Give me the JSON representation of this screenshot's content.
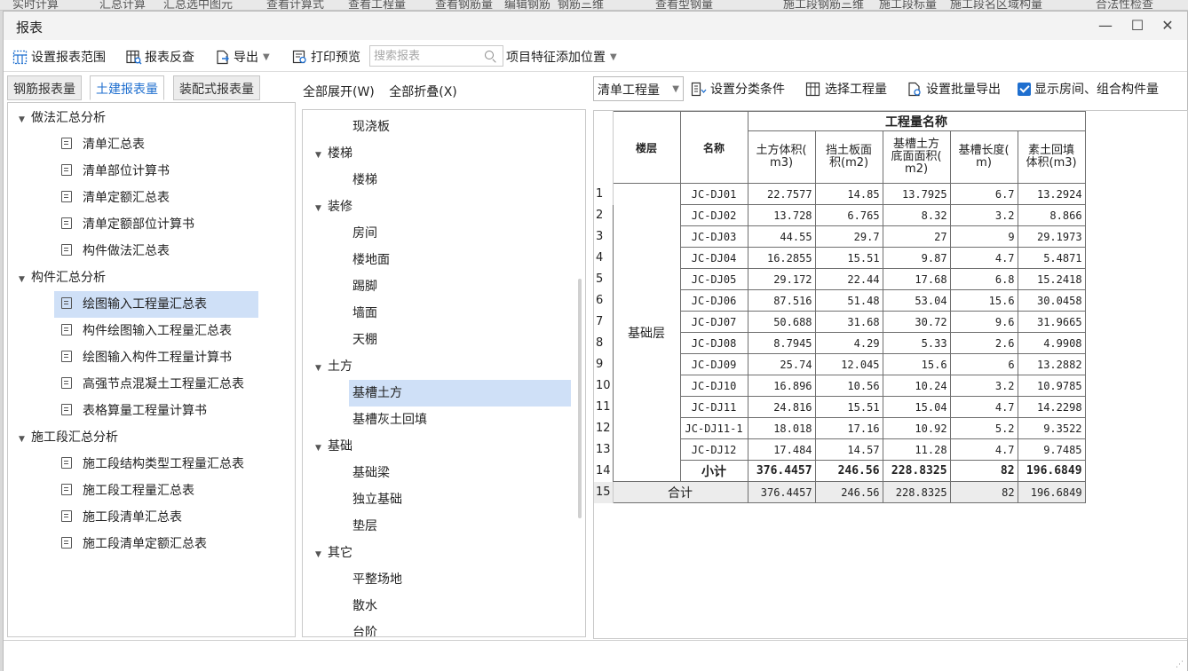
{
  "background_tabs": [
    "实时计算",
    "汇总计算",
    "汇总选中图元",
    "查看计算式",
    "查看工程量",
    "查看钢筋量",
    "编辑钢筋",
    "钢筋三维",
    "查看型钢量",
    "施工段钢筋三维",
    "施工段标量",
    "施工段名区域构量",
    "合法性检查"
  ],
  "window": {
    "title": "报表",
    "minimize": "—",
    "maximize": "☐",
    "close": "✕"
  },
  "toolbar": {
    "set_range": "设置报表范围",
    "reverse_check": "报表反查",
    "export": "导出",
    "print_preview": "打印预览",
    "search_placeholder": "搜索报表",
    "feature_position": "项目特征添加位置"
  },
  "left_tabs": [
    "钢筋报表量",
    "土建报表量",
    "装配式报表量"
  ],
  "left_tree": [
    {
      "label": "做法汇总分析",
      "level": 0
    },
    {
      "label": "清单汇总表",
      "level": 1
    },
    {
      "label": "清单部位计算书",
      "level": 1
    },
    {
      "label": "清单定额汇总表",
      "level": 1
    },
    {
      "label": "清单定额部位计算书",
      "level": 1
    },
    {
      "label": "构件做法汇总表",
      "level": 1
    },
    {
      "label": "构件汇总分析",
      "level": 0
    },
    {
      "label": "绘图输入工程量汇总表",
      "level": 1,
      "selected": true
    },
    {
      "label": "构件绘图输入工程量汇总表",
      "level": 1
    },
    {
      "label": "绘图输入构件工程量计算书",
      "level": 1
    },
    {
      "label": "高强节点混凝土工程量汇总表",
      "level": 1
    },
    {
      "label": "表格算量工程量计算书",
      "level": 1
    },
    {
      "label": "施工段汇总分析",
      "level": 0
    },
    {
      "label": "施工段结构类型工程量汇总表",
      "level": 1
    },
    {
      "label": "施工段工程量汇总表",
      "level": 1
    },
    {
      "label": "施工段清单汇总表",
      "level": 1
    },
    {
      "label": "施工段清单定额汇总表",
      "level": 1
    }
  ],
  "middle": {
    "expand_all": "全部展开(W)",
    "collapse_all": "全部折叠(X)",
    "items": [
      {
        "label": "现浇板",
        "level": 1
      },
      {
        "label": "楼梯",
        "level": 0
      },
      {
        "label": "楼梯",
        "level": 1
      },
      {
        "label": "装修",
        "level": 0
      },
      {
        "label": "房间",
        "level": 1
      },
      {
        "label": "楼地面",
        "level": 1
      },
      {
        "label": "踢脚",
        "level": 1
      },
      {
        "label": "墙面",
        "level": 1
      },
      {
        "label": "天棚",
        "level": 1
      },
      {
        "label": "土方",
        "level": 0
      },
      {
        "label": "基槽土方",
        "level": 1,
        "selected": true
      },
      {
        "label": "基槽灰土回填",
        "level": 1
      },
      {
        "label": "基础",
        "level": 0
      },
      {
        "label": "基础梁",
        "level": 1
      },
      {
        "label": "独立基础",
        "level": 1
      },
      {
        "label": "垫层",
        "level": 1
      },
      {
        "label": "其它",
        "level": 0
      },
      {
        "label": "平整场地",
        "level": 1
      },
      {
        "label": "散水",
        "level": 1
      },
      {
        "label": "台阶",
        "level": 1
      }
    ]
  },
  "right_toolbar": {
    "report_type": "清单工程量",
    "set_category": "设置分类条件",
    "select_quantity": "选择工程量",
    "batch_export": "设置批量导出",
    "show_room": "显示房间、组合构件量",
    "show_room_checked": true
  },
  "table": {
    "group_header": "工程量名称",
    "col_floor": "楼层",
    "col_name": "名称",
    "columns": [
      "土方体积(m3)",
      "挡土板面积(m2)",
      "基槽土方底面面积(m2)",
      "基槽长度(m)",
      "素土回填体积(m3)"
    ],
    "column_lines": [
      [
        "土方体积(",
        "m3)"
      ],
      [
        "挡土板面",
        "积(m2)"
      ],
      [
        "基槽土方",
        "底面面积(",
        "m2)"
      ],
      [
        "基槽长度(",
        "m)"
      ],
      [
        "素土回填",
        "体积(m3)"
      ]
    ],
    "floor": "基础层",
    "rows": [
      {
        "no": "1",
        "name": "JC-DJ01",
        "values": [
          "22.7577",
          "14.85",
          "13.7925",
          "6.7",
          "13.2924"
        ]
      },
      {
        "no": "2",
        "name": "JC-DJ02",
        "values": [
          "13.728",
          "6.765",
          "8.32",
          "3.2",
          "8.866"
        ]
      },
      {
        "no": "3",
        "name": "JC-DJ03",
        "values": [
          "44.55",
          "29.7",
          "27",
          "9",
          "29.1973"
        ]
      },
      {
        "no": "4",
        "name": "JC-DJ04",
        "values": [
          "16.2855",
          "15.51",
          "9.87",
          "4.7",
          "5.4871"
        ]
      },
      {
        "no": "5",
        "name": "JC-DJ05",
        "values": [
          "29.172",
          "22.44",
          "17.68",
          "6.8",
          "15.2418"
        ]
      },
      {
        "no": "6",
        "name": "JC-DJ06",
        "values": [
          "87.516",
          "51.48",
          "53.04",
          "15.6",
          "30.0458"
        ]
      },
      {
        "no": "7",
        "name": "JC-DJ07",
        "values": [
          "50.688",
          "31.68",
          "30.72",
          "9.6",
          "31.9665"
        ]
      },
      {
        "no": "8",
        "name": "JC-DJ08",
        "values": [
          "8.7945",
          "4.29",
          "5.33",
          "2.6",
          "4.9908"
        ]
      },
      {
        "no": "9",
        "name": "JC-DJ09",
        "values": [
          "25.74",
          "12.045",
          "15.6",
          "6",
          "13.2882"
        ]
      },
      {
        "no": "10",
        "name": "JC-DJ10",
        "values": [
          "16.896",
          "10.56",
          "10.24",
          "3.2",
          "10.9785"
        ]
      },
      {
        "no": "11",
        "name": "JC-DJ11",
        "values": [
          "24.816",
          "15.51",
          "15.04",
          "4.7",
          "14.2298"
        ]
      },
      {
        "no": "12",
        "name": "JC-DJ11-1",
        "values": [
          "18.018",
          "17.16",
          "10.92",
          "5.2",
          "9.3522"
        ]
      },
      {
        "no": "13",
        "name": "JC-DJ12",
        "values": [
          "17.484",
          "14.57",
          "11.28",
          "4.7",
          "9.7485"
        ]
      }
    ],
    "subtotal": {
      "no": "14",
      "label": "小计",
      "values": [
        "376.4457",
        "246.56",
        "228.8325",
        "82",
        "196.6849"
      ]
    },
    "total": {
      "no": "15",
      "label": "合计",
      "values": [
        "376.4457",
        "246.56",
        "228.8325",
        "82",
        "196.6849"
      ]
    }
  },
  "colors": {
    "accent": "#1f6fcf",
    "selection": "#cfe0f7"
  }
}
